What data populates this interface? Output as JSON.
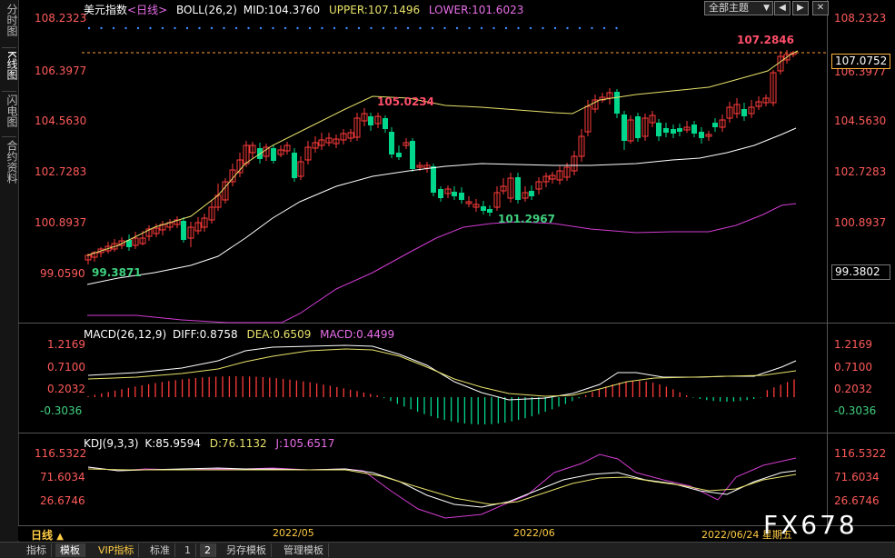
{
  "left_tabs": [
    "分时图",
    "K线图",
    "闪电图",
    "合约资料"
  ],
  "main": {
    "symbol": "美元指数",
    "period_tag": "<日线>",
    "boll_name": "BOLL(26,2)",
    "mid": "MID:104.3760",
    "upper": "UPPER:107.1496",
    "lower": "LOWER:101.6023",
    "y_labels": [
      "108.2323",
      "106.3977",
      "104.5630",
      "102.7283",
      "100.8937",
      "99.0590"
    ],
    "current_price": "107.0752",
    "low_marker": "99.3802",
    "annotations": {
      "high1": "105.0234",
      "high2": "107.2846",
      "low1": "101.2967",
      "low2": "99.3871"
    }
  },
  "toolbar": {
    "theme_select": "全部主题",
    "theme_arrow": "▼",
    "btn_prev": "◀",
    "btn_next": "▶",
    "btn_close": "✕"
  },
  "macd": {
    "name": "MACD(26,12,9)",
    "diff": "DIFF:0.8758",
    "dea": "DEA:0.6509",
    "macd": "MACD:0.4499",
    "y_labels": [
      "1.2169",
      "0.7100",
      "0.2032",
      "-0.3036"
    ]
  },
  "kdj": {
    "name": "KDJ(9,3,3)",
    "k": "K:85.9594",
    "d": "D:76.1132",
    "j": "J:105.6517",
    "y_labels": [
      "116.5322",
      "71.6034",
      "26.6746"
    ]
  },
  "xaxis": {
    "period_label": "日线",
    "arrow": "▲",
    "dates": [
      "2022/05",
      "2022/06"
    ],
    "current": "2022/06/24 星期五"
  },
  "bottom_tabs": [
    "指标",
    "模板",
    "VIP指标",
    "标准",
    "1",
    "2",
    "另存模板",
    "管理模板"
  ],
  "watermark": "FX678",
  "colors": {
    "up": "#ff3b3b",
    "down": "#00d78c",
    "upper": "#e8e26a",
    "mid": "#ffffff",
    "lower": "#d23cd2",
    "dea": "#e8e26a"
  }
}
